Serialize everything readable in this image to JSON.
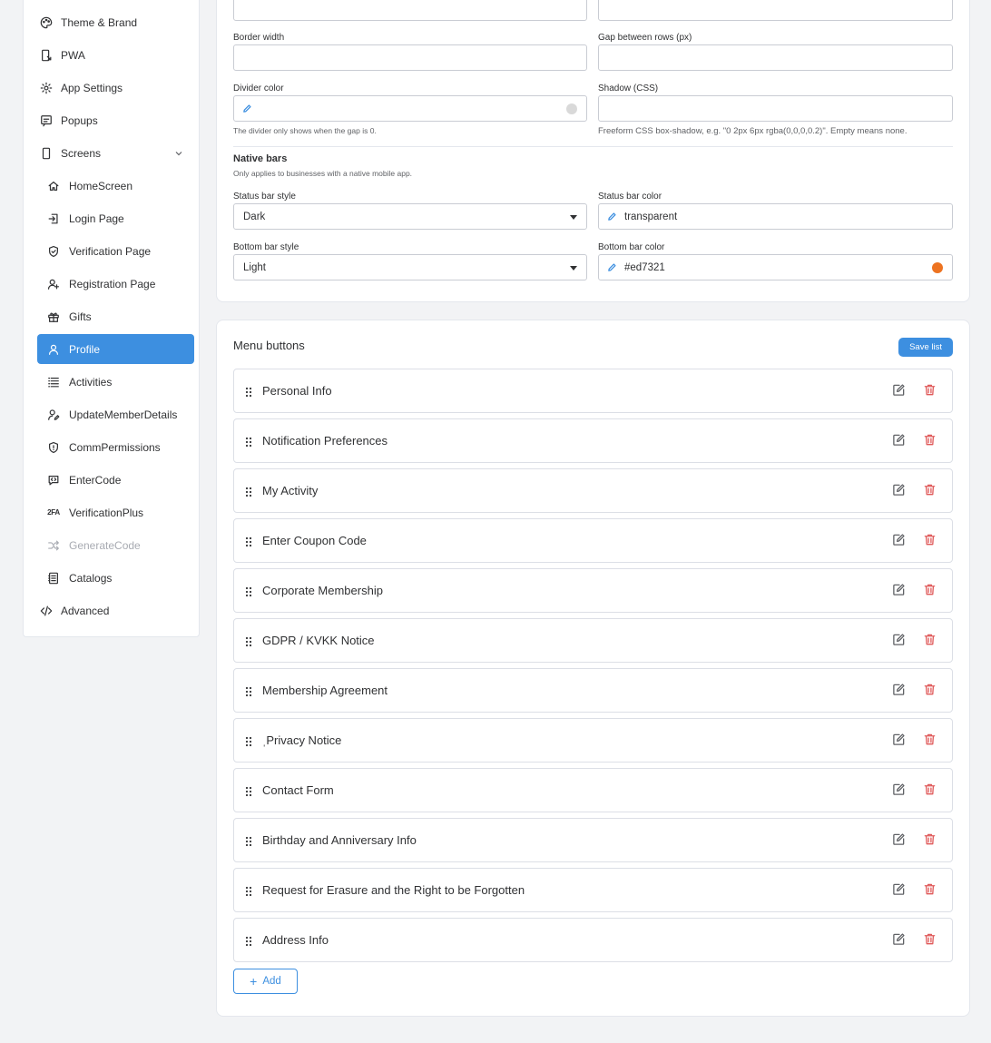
{
  "sidebar": {
    "items": [
      {
        "label": "Theme & Brand",
        "icon": "palette-icon"
      },
      {
        "label": "PWA",
        "icon": "mobile-link-icon"
      },
      {
        "label": "App Settings",
        "icon": "settings-gear-icon"
      },
      {
        "label": "Popups",
        "icon": "popup-icon"
      },
      {
        "label": "Screens",
        "icon": "phone-icon"
      },
      {
        "label": "HomeScreen",
        "icon": "home-icon"
      },
      {
        "label": "Login Page",
        "icon": "login-icon"
      },
      {
        "label": "Verification Page",
        "icon": "shield-check-icon"
      },
      {
        "label": "Registration Page",
        "icon": "user-plus-icon"
      },
      {
        "label": "Gifts",
        "icon": "gift-icon"
      },
      {
        "label": "Profile",
        "icon": "user-icon"
      },
      {
        "label": "Activities",
        "icon": "list-icon"
      },
      {
        "label": "UpdateMemberDetails",
        "icon": "user-edit-icon"
      },
      {
        "label": "CommPermissions",
        "icon": "shield-icon"
      },
      {
        "label": "EnterCode",
        "icon": "code-chat-icon"
      },
      {
        "label": "VerificationPlus",
        "icon": "two-factor-icon",
        "glyph": "2FA"
      },
      {
        "label": "GenerateCode",
        "icon": "shuffle-icon"
      },
      {
        "label": "Catalogs",
        "icon": "catalog-icon"
      },
      {
        "label": "Advanced",
        "icon": "code-icon"
      }
    ],
    "active": "Profile"
  },
  "settings": {
    "border_width_label": "Border width",
    "border_width_value": "",
    "gap_label": "Gap between rows (px)",
    "gap_value": "",
    "divider_color_label": "Divider color",
    "divider_color_value": "",
    "divider_help": "The divider only shows when the gap is 0.",
    "shadow_label": "Shadow (CSS)",
    "shadow_value": "",
    "shadow_help": "Freeform CSS box-shadow, e.g. \"0 2px 6px rgba(0,0,0,0.2)\". Empty means none.",
    "native_bars_title": "Native bars",
    "native_bars_help": "Only applies to businesses with a native mobile app.",
    "status_bar_style_label": "Status bar style",
    "status_bar_style_value": "Dark",
    "status_bar_color_label": "Status bar color",
    "status_bar_color_value": "transparent",
    "bottom_bar_style_label": "Bottom bar style",
    "bottom_bar_style_value": "Light",
    "bottom_bar_color_label": "Bottom bar color",
    "bottom_bar_color_value": "#ed7321",
    "colors": {
      "divider_swatch": "#d9d9d9",
      "bottom_bar_swatch": "#ed7321",
      "accent": "#3d8fe0",
      "delete": "#e05a5a"
    }
  },
  "menu": {
    "title": "Menu buttons",
    "save_label": "Save list",
    "add_label": "Add",
    "items": [
      "Personal Info",
      "Notification Preferences",
      "My Activity",
      "Enter Coupon Code",
      "Corporate Membership",
      "GDPR / KVKK Notice",
      "Membership Agreement",
      "ˌPrivacy Notice",
      "Contact Form",
      "Birthday and Anniversary Info",
      "Request for Erasure and the Right to be Forgotten",
      "Address Info"
    ]
  }
}
